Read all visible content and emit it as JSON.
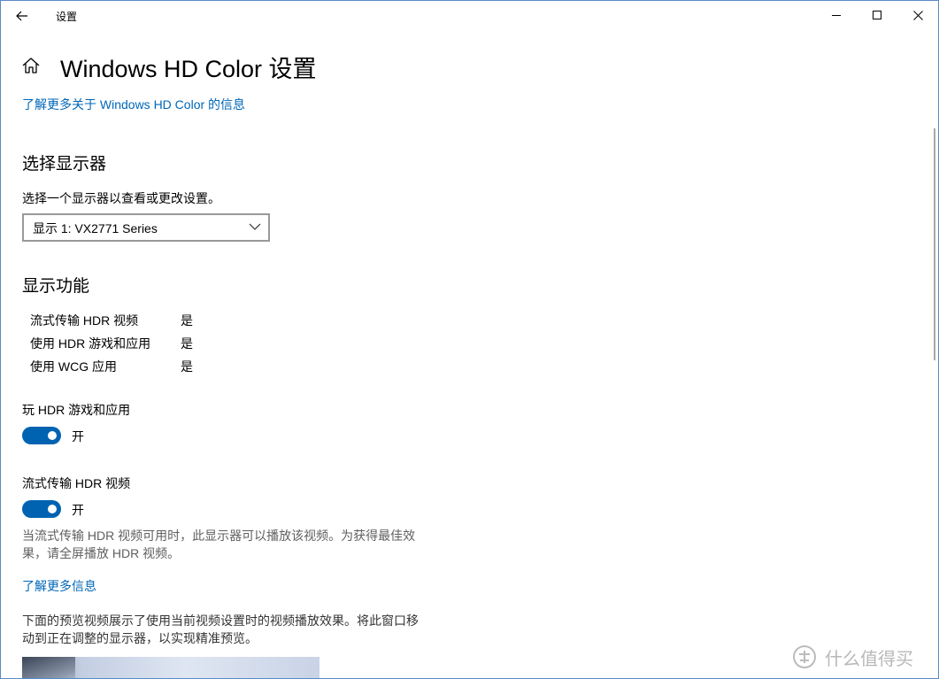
{
  "window": {
    "title": "设置"
  },
  "header": {
    "page_title": "Windows HD Color 设置",
    "learn_more_link": "了解更多关于 Windows HD Color 的信息"
  },
  "display_select": {
    "heading": "选择显示器",
    "instruction": "选择一个显示器以查看或更改设置。",
    "selected_display": "显示 1: VX2771 Series"
  },
  "capabilities": {
    "heading": "显示功能",
    "items": [
      {
        "name": "流式传输 HDR 视频",
        "value": "是"
      },
      {
        "name": "使用 HDR 游戏和应用",
        "value": "是"
      },
      {
        "name": "使用 WCG 应用",
        "value": "是"
      }
    ]
  },
  "hdr_games": {
    "label": "玩 HDR 游戏和应用",
    "state_label": "开",
    "enabled": true
  },
  "hdr_video": {
    "label": "流式传输 HDR 视频",
    "state_label": "开",
    "enabled": true,
    "description": "当流式传输 HDR 视频可用时，此显示器可以播放该视频。为获得最佳效果，请全屏播放 HDR 视频。",
    "learn_more_link": "了解更多信息"
  },
  "preview": {
    "description": "下面的预览视频展示了使用当前视频设置时的视频播放效果。将此窗口移动到正在调整的显示器，以实现精准预览。"
  },
  "watermark": {
    "text": "什么值得买"
  },
  "colors": {
    "accent": "#0063b1",
    "link": "#0067b8"
  }
}
